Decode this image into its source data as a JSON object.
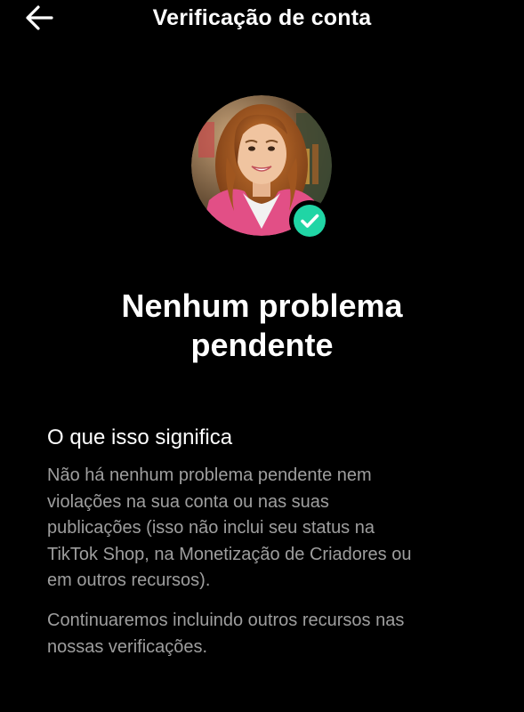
{
  "header": {
    "title": "Verificação de conta",
    "back_icon": "arrow-left-icon"
  },
  "profile": {
    "avatar_alt": "Profile photo",
    "badge_icon": "verified-check-icon",
    "badge_color": "#20d5a5"
  },
  "status": {
    "line1": "Nenhum problema",
    "line2": "pendente"
  },
  "section": {
    "heading": "O que isso significa",
    "paragraph1": [
      "Não há nenhum problema pendente nem",
      "violações na sua conta ou nas suas",
      "publicações (isso não inclui seu status na",
      "TikTok Shop, na Monetização de Criadores ou",
      "em outros recursos)."
    ],
    "paragraph2": [
      "Continuaremos incluindo outros recursos nas",
      "nossas verificações."
    ]
  },
  "colors": {
    "background": "#000000",
    "text_primary": "#ffffff",
    "text_secondary": "#9e9e9e",
    "accent": "#20d5a5"
  }
}
